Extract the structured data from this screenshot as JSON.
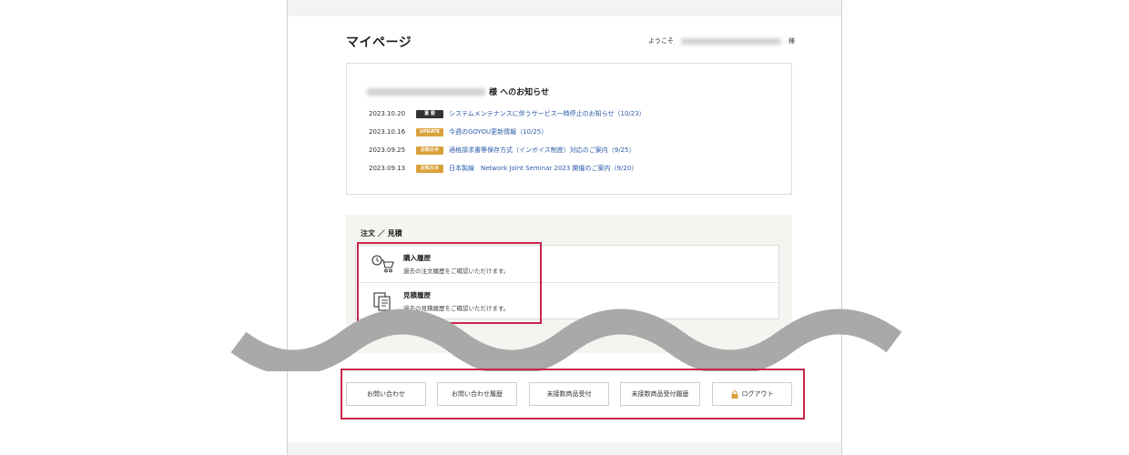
{
  "header": {
    "title": "マイページ",
    "welcome_prefix": "ようこそ",
    "welcome_suffix": "様"
  },
  "notices": {
    "heading_suffix": "様 へのお知らせ",
    "items": [
      {
        "date": "2023.10.20",
        "badge": "重 要",
        "badge_color": "#333333",
        "text": "システムメンテナンスに伴うサービス一時停止のお知らせ（10/23）"
      },
      {
        "date": "2023.10.16",
        "badge": "UPDATE",
        "badge_color": "#d9a13b",
        "text": "今週のGOYOU更新情報（10/25）"
      },
      {
        "date": "2023.09.25",
        "badge": "お知らせ",
        "badge_color": "#d9a13b",
        "text": "適格請求書等保存方式（インボイス制度）対応のご案内（9/25）"
      },
      {
        "date": "2023.09.13",
        "badge": "お知らせ",
        "badge_color": "#d9a13b",
        "text": "日本製線　Network Joint Seminar 2023 開催のご案内（9/20）"
      }
    ]
  },
  "orders": {
    "title": "注文 ／ 見積",
    "items": [
      {
        "name": "購入履歴",
        "desc": "過去の注文履歴をご確認いただけます。",
        "icon": "cart-clock-icon"
      },
      {
        "name": "見積履歴",
        "desc": "過去の見積履歴をご確認いただけます。",
        "icon": "document-stack-icon"
      }
    ]
  },
  "buttons": {
    "inquiry": "お問い合わせ",
    "inquiry_history": "お問い合わせ履歴",
    "undelivered_receipt": "未接数商品受付",
    "undelivered_history": "未接数商品受付履歴",
    "logout": "ログアウト"
  },
  "colors": {
    "highlight": "#c8274a",
    "link": "#2a5aa8",
    "badge_important": "#333333",
    "badge_update": "#d9a13b"
  }
}
